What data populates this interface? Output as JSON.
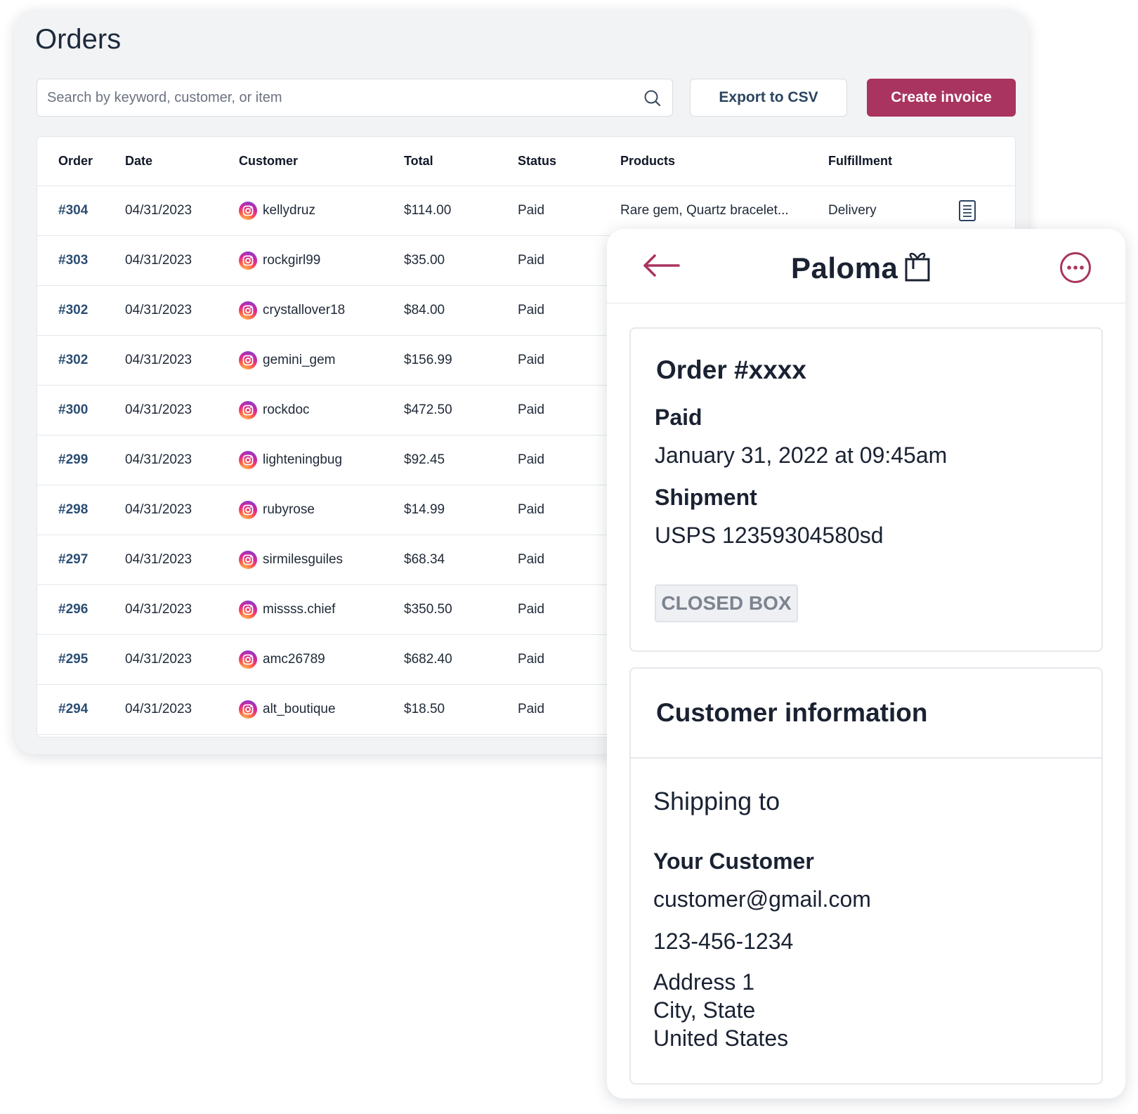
{
  "orders_page": {
    "title": "Orders",
    "search": {
      "placeholder": "Search by keyword, customer, or item",
      "value": ""
    },
    "export_label": "Export to CSV",
    "create_label": "Create invoice",
    "columns": [
      "Order",
      "Date",
      "Customer",
      "Total",
      "Status",
      "Products",
      "Fulfillment"
    ],
    "rows": [
      {
        "order": "#304",
        "date": "04/31/2023",
        "customer": "kellydruz",
        "total": "$114.00",
        "status": "Paid",
        "products": "Rare gem, Quartz bracelet...",
        "fulfillment": "Delivery"
      },
      {
        "order": "#303",
        "date": "04/31/2023",
        "customer": "rockgirl99",
        "total": "$35.00",
        "status": "Paid"
      },
      {
        "order": "#302",
        "date": "04/31/2023",
        "customer": "crystallover18",
        "total": "$84.00",
        "status": "Paid"
      },
      {
        "order": "#302",
        "date": "04/31/2023",
        "customer": "gemini_gem",
        "total": "$156.99",
        "status": "Paid"
      },
      {
        "order": "#300",
        "date": "04/31/2023",
        "customer": "rockdoc",
        "total": "$472.50",
        "status": "Paid"
      },
      {
        "order": "#299",
        "date": "04/31/2023",
        "customer": "lighteningbug",
        "total": "$92.45",
        "status": "Paid"
      },
      {
        "order": "#298",
        "date": "04/31/2023",
        "customer": "rubyrose",
        "total": "$14.99",
        "status": "Paid"
      },
      {
        "order": "#297",
        "date": "04/31/2023",
        "customer": "sirmilesguiles",
        "total": "$68.34",
        "status": "Paid"
      },
      {
        "order": "#296",
        "date": "04/31/2023",
        "customer": "missss.chief",
        "total": "$350.50",
        "status": "Paid"
      },
      {
        "order": "#295",
        "date": "04/31/2023",
        "customer": "amc26789",
        "total": "$682.40",
        "status": "Paid"
      },
      {
        "order": "#294",
        "date": "04/31/2023",
        "customer": "alt_boutique",
        "total": "$18.50",
        "status": "Paid"
      }
    ]
  },
  "detail": {
    "brand": "Paloma",
    "order_title": "Order #xxxx",
    "paid_label": "Paid",
    "paid_date": "January 31, 2022 at 09:45am",
    "shipment_label": "Shipment",
    "shipment_value": "USPS 12359304580sd",
    "badge": "CLOSED BOX",
    "customer_title": "Customer information",
    "shipping_to": "Shipping to",
    "customer_name": "Your Customer",
    "email": "customer@gmail.com",
    "phone": "123-456-1234",
    "address": [
      "Address 1",
      "City, State",
      "United States"
    ]
  },
  "icons": {
    "search": "search-icon",
    "customer_source": "instagram-icon",
    "invoice": "document-icon",
    "back": "arrow-left-icon",
    "brand_mark": "gift-bag-icon",
    "more": "more-options-icon"
  },
  "colors": {
    "accent": "#a9345f",
    "order_link": "#2b4d73",
    "badge_text": "#7d8490"
  }
}
